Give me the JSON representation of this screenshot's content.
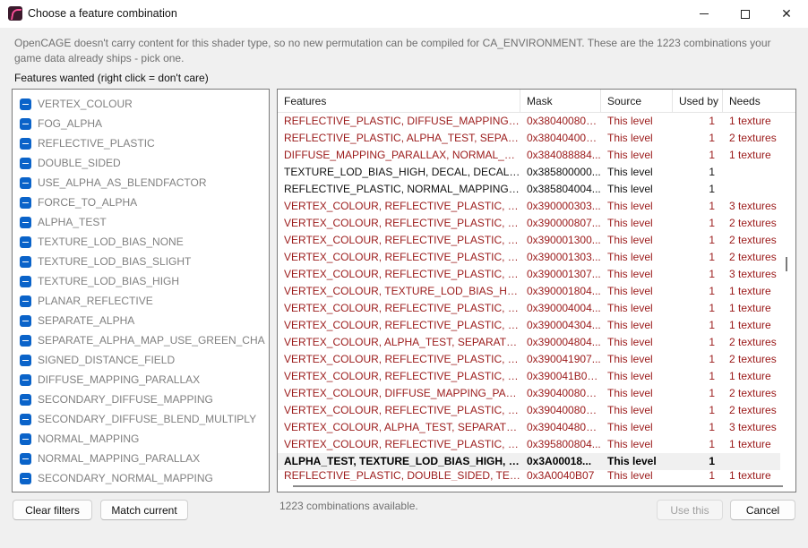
{
  "window": {
    "title": "Choose a feature combination",
    "icon": "opencage-app-icon",
    "controls": [
      "minimize",
      "maximize",
      "close"
    ]
  },
  "description": "OpenCAGE doesn't carry content for this shader type, so no new permutation can be compiled for CA_ENVIRONMENT. These are the 1223 combinations your game data already ships - pick one.",
  "features_label": "Features wanted  (right click = don't care)",
  "features": [
    "VERTEX_COLOUR",
    "FOG_ALPHA",
    "REFLECTIVE_PLASTIC",
    "DOUBLE_SIDED",
    "USE_ALPHA_AS_BLENDFACTOR",
    "FORCE_TO_ALPHA",
    "ALPHA_TEST",
    "TEXTURE_LOD_BIAS_NONE",
    "TEXTURE_LOD_BIAS_SLIGHT",
    "TEXTURE_LOD_BIAS_HIGH",
    "PLANAR_REFLECTIVE",
    "SEPARATE_ALPHA",
    "SEPARATE_ALPHA_MAP_USE_GREEN_CHA",
    "SIGNED_DISTANCE_FIELD",
    "DIFFUSE_MAPPING_PARALLAX",
    "SECONDARY_DIFFUSE_MAPPING",
    "SECONDARY_DIFFUSE_BLEND_MULTIPLY",
    "NORMAL_MAPPING",
    "NORMAL_MAPPING_PARALLAX",
    "SECONDARY_NORMAL_MAPPING"
  ],
  "table": {
    "columns": [
      "Features",
      "Mask",
      "Source",
      "Used by",
      "Needs"
    ],
    "rows": [
      {
        "features": "REFLECTIVE_PLASTIC, DIFFUSE_MAPPING_PARALLAX",
        "mask": "0x38040080C...",
        "source": "This level",
        "used_by": "1",
        "needs": "1 texture",
        "style": "red"
      },
      {
        "features": "REFLECTIVE_PLASTIC, ALPHA_TEST, SEPARATE_...",
        "mask": "0x38040400C...",
        "source": "This level",
        "used_by": "1",
        "needs": "2 textures",
        "style": "red"
      },
      {
        "features": "DIFFUSE_MAPPING_PARALLAX, NORMAL_MAP...",
        "mask": "0x384088884...",
        "source": "This level",
        "used_by": "1",
        "needs": "1 texture",
        "style": "red"
      },
      {
        "features": "TEXTURE_LOD_BIAS_HIGH, DECAL, DECAL_DIFF...",
        "mask": "0x385800000...",
        "source": "This level",
        "used_by": "1",
        "needs": "",
        "style": "black"
      },
      {
        "features": "REFLECTIVE_PLASTIC, NORMAL_MAPPING, SPE...",
        "mask": "0x385804004...",
        "source": "This level",
        "used_by": "1",
        "needs": "",
        "style": "black"
      },
      {
        "features": "VERTEX_COLOUR, REFLECTIVE_PLASTIC, TEXTU...",
        "mask": "0x390000303...",
        "source": "This level",
        "used_by": "1",
        "needs": "3 textures",
        "style": "red"
      },
      {
        "features": "VERTEX_COLOUR, REFLECTIVE_PLASTIC, TEXTU...",
        "mask": "0x390000807...",
        "source": "This level",
        "used_by": "1",
        "needs": "2 textures",
        "style": "red"
      },
      {
        "features": "VERTEX_COLOUR, REFLECTIVE_PLASTIC, TEXTU...",
        "mask": "0x390001300...",
        "source": "This level",
        "used_by": "1",
        "needs": "2 textures",
        "style": "red"
      },
      {
        "features": "VERTEX_COLOUR, REFLECTIVE_PLASTIC, TEXTU...",
        "mask": "0x390001303...",
        "source": "This level",
        "used_by": "1",
        "needs": "2 textures",
        "style": "red"
      },
      {
        "features": "VERTEX_COLOUR, REFLECTIVE_PLASTIC, TEXTU...",
        "mask": "0x390001307...",
        "source": "This level",
        "used_by": "1",
        "needs": "3 textures",
        "style": "red"
      },
      {
        "features": "VERTEX_COLOUR, TEXTURE_LOD_BIAS_HIGH, N...",
        "mask": "0x390001804...",
        "source": "This level",
        "used_by": "1",
        "needs": "1 texture",
        "style": "red"
      },
      {
        "features": "VERTEX_COLOUR, REFLECTIVE_PLASTIC, SPECU...",
        "mask": "0x390004004...",
        "source": "This level",
        "used_by": "1",
        "needs": "1 texture",
        "style": "red"
      },
      {
        "features": "VERTEX_COLOUR, REFLECTIVE_PLASTIC, NORM...",
        "mask": "0x390004304...",
        "source": "This level",
        "used_by": "1",
        "needs": "1 texture",
        "style": "red"
      },
      {
        "features": "VERTEX_COLOUR, ALPHA_TEST, SEPARATE_ALP...",
        "mask": "0x390004804...",
        "source": "This level",
        "used_by": "1",
        "needs": "2 textures",
        "style": "red"
      },
      {
        "features": "VERTEX_COLOUR, REFLECTIVE_PLASTIC, TEXTU...",
        "mask": "0x390041907...",
        "source": "This level",
        "used_by": "1",
        "needs": "2 textures",
        "style": "red"
      },
      {
        "features": "VERTEX_COLOUR, REFLECTIVE_PLASTIC, TEXTU...",
        "mask": "0x390041B04...",
        "source": "This level",
        "used_by": "1",
        "needs": "1 texture",
        "style": "red"
      },
      {
        "features": "VERTEX_COLOUR, DIFFUSE_MAPPING_PARALLA...",
        "mask": "0x39040080C...",
        "source": "This level",
        "used_by": "1",
        "needs": "2 textures",
        "style": "red"
      },
      {
        "features": "VERTEX_COLOUR, REFLECTIVE_PLASTIC, DIFFUS...",
        "mask": "0x39040080C...",
        "source": "This level",
        "used_by": "1",
        "needs": "2 textures",
        "style": "red"
      },
      {
        "features": "VERTEX_COLOUR, ALPHA_TEST, SEPARATE_ALP...",
        "mask": "0x39040480C...",
        "source": "This level",
        "used_by": "1",
        "needs": "3 textures",
        "style": "red"
      },
      {
        "features": "VERTEX_COLOUR, REFLECTIVE_PLASTIC, SPECU...",
        "mask": "0x395800804...",
        "source": "This level",
        "used_by": "1",
        "needs": "1 texture",
        "style": "red"
      },
      {
        "features": "ALPHA_TEST, TEXTURE_LOD_BIAS_HIGH, NOR...",
        "mask": "0x3A00018...",
        "source": "This level",
        "used_by": "1",
        "needs": "",
        "style": "selected"
      },
      {
        "features": "REFLECTIVE_PLASTIC, DOUBLE_SIDED, TEXTURE",
        "mask": "0x3A0040B07",
        "source": "This level",
        "used_by": "1",
        "needs": "1 texture",
        "style": "red"
      }
    ]
  },
  "status": "1223 combinations available.",
  "buttons": {
    "clear_filters": "Clear filters",
    "match_current": "Match current",
    "use_this": "Use this",
    "cancel": "Cancel"
  },
  "colors": {
    "accent": "#0a63c9",
    "unavailable_text": "#9b1a1a",
    "available_text": "#111111"
  }
}
